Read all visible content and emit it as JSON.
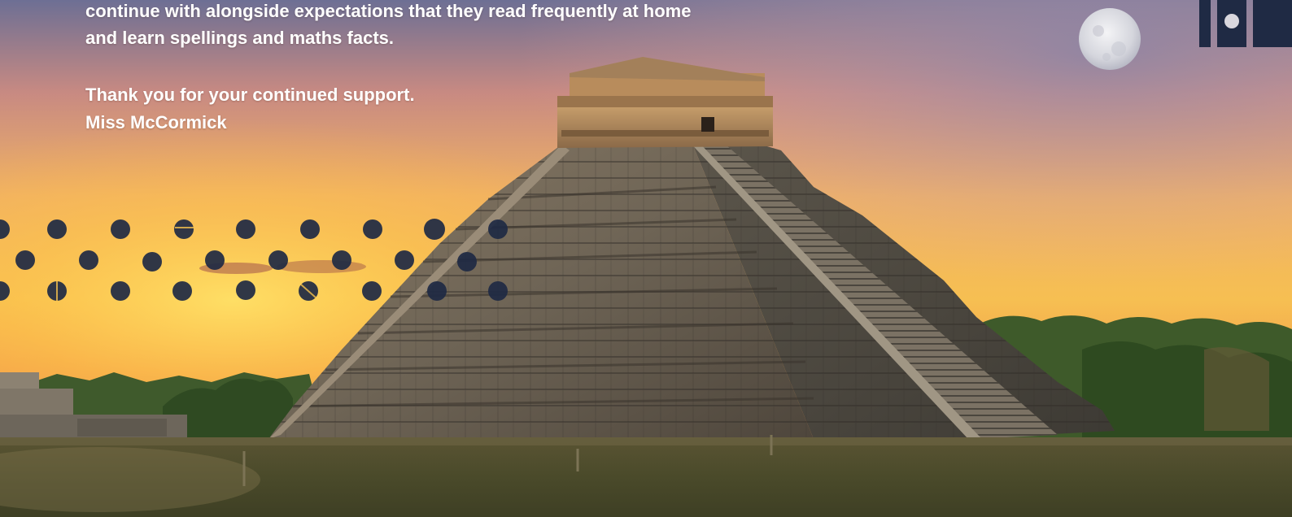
{
  "letter": {
    "line1": "continue with alongside expectations that they read frequently at home",
    "line2": "and learn spellings and maths facts.",
    "thanks": "Thank you for your continued support.",
    "signature": "Miss McCormick"
  },
  "colors": {
    "text": "#ffffff",
    "dots": "#1f2a44",
    "logo": "#1f2a44"
  },
  "image": {
    "subject": "pyramid-photo",
    "decor": "dot-pattern"
  }
}
